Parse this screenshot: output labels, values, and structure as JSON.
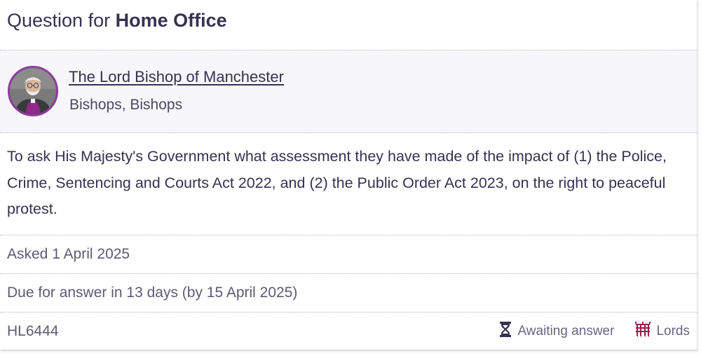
{
  "header": {
    "prefix": "Question for",
    "department": "Home Office"
  },
  "member": {
    "name": "The Lord Bishop of Manchester",
    "party": "Bishops, Bishops"
  },
  "question": {
    "text": "To ask His Majesty's Government what assessment they have made of the impact of (1) the Police, Crime, Sentencing and Courts Act 2022, and (2) the Public Order Act 2023, on the right to peaceful protest."
  },
  "asked": "Asked 1 April 2025",
  "due": "Due for answer in 13 days (by 15 April 2025)",
  "footer": {
    "reference": "HL6444",
    "status": {
      "label": "Awaiting answer",
      "icon": "hourglass-icon"
    },
    "house": {
      "label": "Lords",
      "icon": "portcullis-icon"
    }
  },
  "colors": {
    "text": "#373151",
    "muted": "#5f5a73",
    "member_band": "#f7f6fa",
    "avatar_border": "#8a3d9a",
    "lords": "#9c1e4a"
  }
}
